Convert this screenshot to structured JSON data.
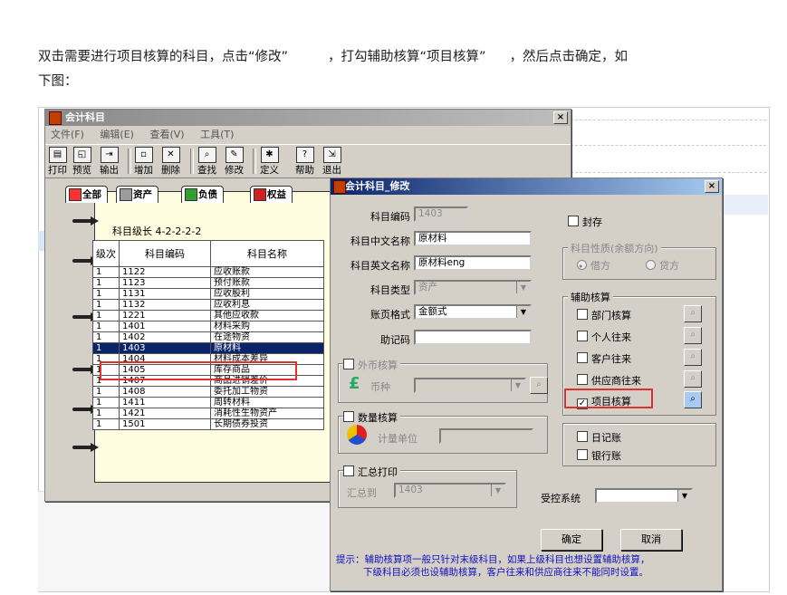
{
  "intro": {
    "line1_a": "双击需要进行项目核算的科目，点击“修改”",
    "line1_b": "，打勾辅助核算“项目核算”",
    "line1_c": "，然后点击确定，如",
    "line2": "下图："
  },
  "main_window": {
    "title": "会计科目",
    "close_label": "×",
    "menu": [
      "文件(F)",
      "编辑(E)",
      "查看(V)",
      "工具(T)"
    ],
    "toolbar": [
      "打印",
      "预览",
      "输出",
      "增加",
      "删除",
      "查找",
      "修改",
      "定义",
      "帮助",
      "退出"
    ],
    "tabs": [
      "全部",
      "资产",
      "负债",
      "权益"
    ],
    "level_label": "科目级长  4-2-2-2-2",
    "table_headers": [
      "级次",
      "科目编码",
      "科目名称"
    ],
    "rows": [
      [
        "1",
        "1122",
        "应收账款"
      ],
      [
        "1",
        "1123",
        "预付账款"
      ],
      [
        "1",
        "1131",
        "应收股利"
      ],
      [
        "1",
        "1132",
        "应收利息"
      ],
      [
        "1",
        "1221",
        "其他应收款"
      ],
      [
        "1",
        "1401",
        "材料采购"
      ],
      [
        "1",
        "1402",
        "在途物资"
      ],
      [
        "1",
        "1403",
        "原材料"
      ],
      [
        "1",
        "1404",
        "材料成本差异"
      ],
      [
        "1",
        "1405",
        "库存商品"
      ],
      [
        "1",
        "1407",
        "商品进销差价"
      ],
      [
        "1",
        "1408",
        "委托加工物资"
      ],
      [
        "1",
        "1411",
        "周转材料"
      ],
      [
        "1",
        "1421",
        "消耗性生物资产"
      ],
      [
        "1",
        "1501",
        "长期债券投资"
      ]
    ],
    "selected_row": 7
  },
  "dialog": {
    "title": "会计科目_修改",
    "close_label": "×",
    "code_label": "科目编码",
    "code_value": "1403",
    "cn_name_label": "科目中文名称",
    "cn_name_value": "原材料",
    "en_name_label": "科目英文名称",
    "en_name_value": "原材料eng",
    "type_label": "科目类型",
    "type_value": "资产",
    "format_label": "账页格式",
    "format_value": "金额式",
    "mnemonic_label": "助记码",
    "mnemonic_value": "",
    "foreign_group": "外币核算",
    "currency_label": "币种",
    "quantity_group": "数量核算",
    "unit_label": "计量单位",
    "summary_group": "汇总打印",
    "summary_to_label": "汇总到",
    "summary_to_value": "1403",
    "sealed_label": "封存",
    "nature_group": "科目性质(余额方向)",
    "debit_label": "借方",
    "credit_label": "贷方",
    "aux_group": "辅助核算",
    "aux_items": [
      "部门核算",
      "个人往来",
      "客户往来",
      "供应商往来",
      "项目核算"
    ],
    "aux_checked": [
      false,
      false,
      false,
      false,
      true
    ],
    "journal_label": "日记账",
    "bank_label": "银行账",
    "controlled_label": "受控系统",
    "controlled_value": "",
    "ok_label": "确定",
    "cancel_label": "取消",
    "tip_line1": "提示：辅助核算项一般只针对末级科目，如果上级科目也想设置辅助核算，",
    "tip_line2": "下级科目必须也设辅助核算，客户往来和供应商往来不能同时设置。",
    "check_mark": "✓",
    "search_glyph": "🔍"
  },
  "colors": {
    "dialog_title": "#0a246a",
    "selection": "#0a246a",
    "highlight_box": "#e03030",
    "tip_text": "#1010c0"
  }
}
